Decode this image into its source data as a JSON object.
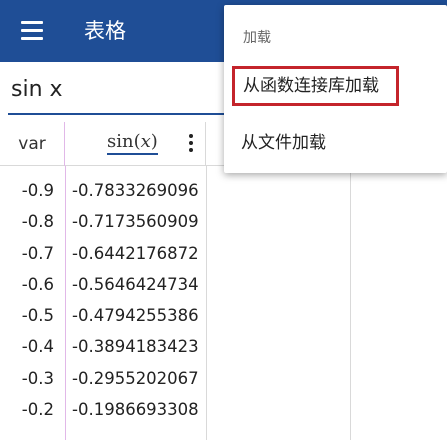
{
  "app_bar": {
    "title": "表格",
    "background": "#1f4e96"
  },
  "input": {
    "value": "sin x"
  },
  "table": {
    "columns": {
      "var": "var",
      "fn_prefix": "sin",
      "fn_paren_open": "(",
      "fn_var": "x",
      "fn_paren_close": ")"
    },
    "rows": [
      {
        "x": "-0.9",
        "y": "-0.7833269096"
      },
      {
        "x": "-0.8",
        "y": "-0.7173560909"
      },
      {
        "x": "-0.7",
        "y": "-0.6442176872"
      },
      {
        "x": "-0.6",
        "y": "-0.5646424734"
      },
      {
        "x": "-0.5",
        "y": "-0.4794255386"
      },
      {
        "x": "-0.4",
        "y": "-0.3894183423"
      },
      {
        "x": "-0.3",
        "y": "-0.2955202067"
      },
      {
        "x": "-0.2",
        "y": "-0.1986693308"
      }
    ]
  },
  "menu": {
    "header": "加载",
    "items": [
      "从函数连接库加载",
      "从文件加载"
    ],
    "highlight_color": "#c4242b"
  }
}
